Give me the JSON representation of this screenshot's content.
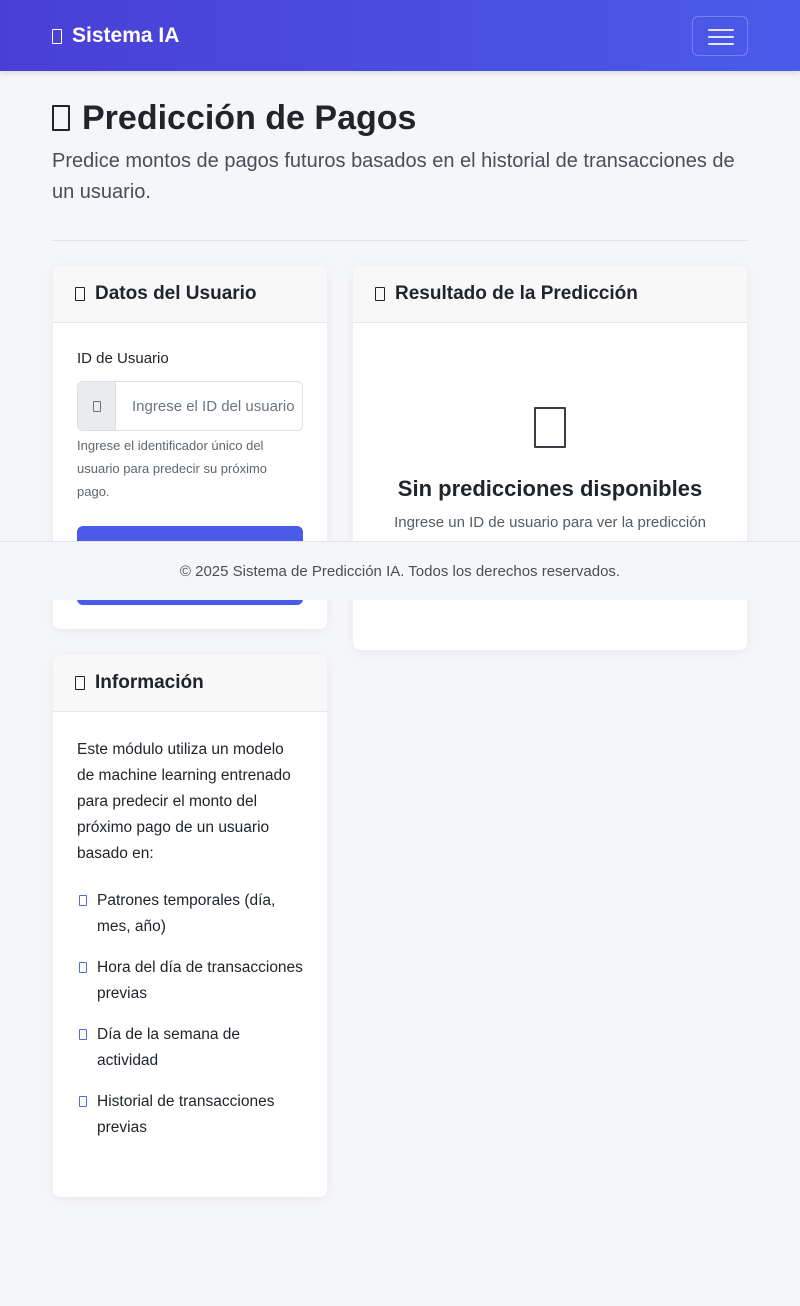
{
  "navbar": {
    "brand_label": "Sistema IA",
    "brand_icon": "brain-icon",
    "toggle_icon": "hamburger-menu-icon",
    "background_gradient": [
      "#4a3fd4",
      "#4a5bea"
    ]
  },
  "page": {
    "title": "Predicción de Pagos",
    "title_icon": "chart-icon",
    "subtitle": "Predice montos de pagos futuros basados en el historial de transacciones de un usuario."
  },
  "user_card": {
    "header": "Datos del Usuario",
    "header_icon": "user-icon",
    "user_id_label": "ID de Usuario",
    "user_id_value": "",
    "user_id_placeholder": "Ingrese el ID del usuario",
    "input_icon": "id-card-icon",
    "help_text": "Ingrese el identificador único del usuario para predecir su próximo pago.",
    "submit_color": "#4a5bea"
  },
  "result_card": {
    "header": "Resultado de la Predicción",
    "header_icon": "chart-line-icon",
    "empty_icon": "empty-state-icon",
    "empty_title": "Sin predicciones disponibles",
    "empty_subtitle": "Ingrese un ID de usuario para ver la predicción"
  },
  "info_card": {
    "header": "Información",
    "header_icon": "info-icon",
    "description": "Este módulo utiliza un modelo de machine learning entrenado para predecir el monto del próximo pago de un usuario basado en:",
    "features": [
      {
        "label": "Patrones temporales (día, mes, año)",
        "icon": "check-icon"
      },
      {
        "label": "Hora del día de transacciones previas",
        "icon": "check-icon"
      },
      {
        "label": "Día de la semana de actividad",
        "icon": "check-icon"
      },
      {
        "label": "Historial de transacciones previas",
        "icon": "check-icon"
      }
    ]
  },
  "footer": {
    "text": "© 2025 Sistema de Predicción IA. Todos los derechos reservados."
  }
}
